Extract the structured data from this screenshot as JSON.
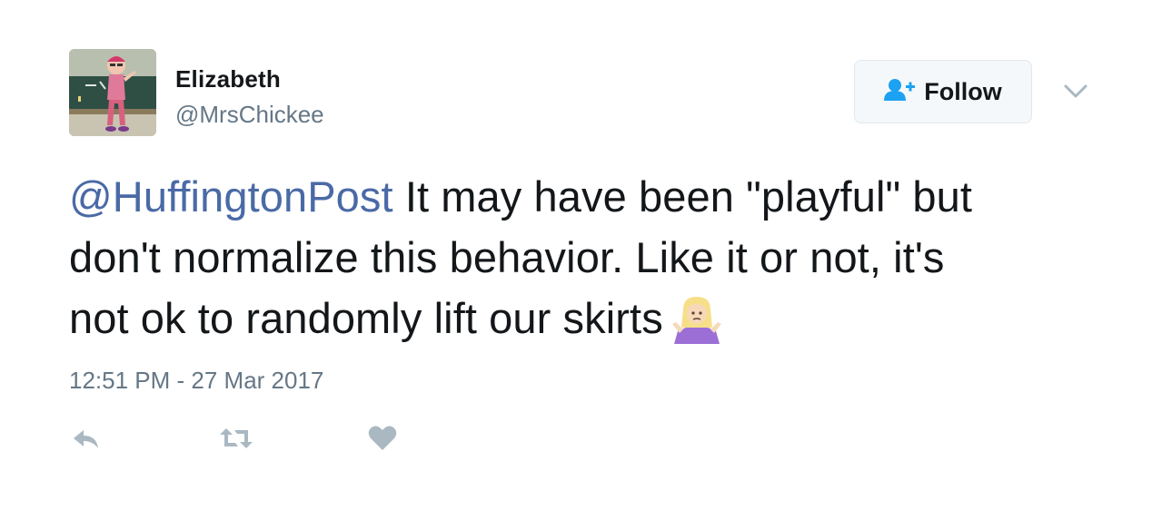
{
  "user": {
    "display_name": "Elizabeth",
    "handle": "@MrsChickee"
  },
  "follow_button": {
    "label": "Follow"
  },
  "tweet": {
    "mention": "@HuffingtonPost",
    "line1_rest": " It may have been \"playful\" but",
    "line2": "don't normalize this behavior. Like it or not, it's",
    "line3": "not ok to randomly lift our skirts",
    "emoji": "person-shrugging-emoji",
    "timestamp": "12:51 PM - 27 Mar 2017"
  },
  "icons": {
    "follow": "follow-user-icon",
    "menu": "chevron-down-icon",
    "reply": "reply-icon",
    "retweet": "retweet-icon",
    "like": "heart-icon"
  },
  "colors": {
    "link": "#4a6aa6",
    "secondary_text": "#657786",
    "icon_gray": "#aab8c2",
    "follow_icon": "#1da1f2"
  }
}
